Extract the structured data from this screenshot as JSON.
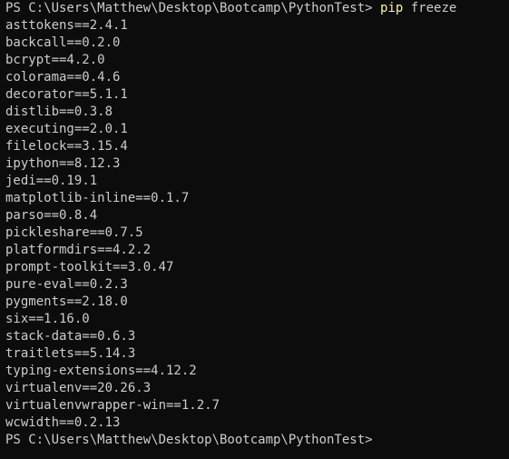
{
  "terminal": {
    "prompt": "PS C:\\Users\\Matthew\\Desktop\\Bootcamp\\PythonTest> ",
    "command_name": "pip",
    "command_args": " freeze",
    "output_lines": [
      "asttokens==2.4.1",
      "backcall==0.2.0",
      "bcrypt==4.2.0",
      "colorama==0.4.6",
      "decorator==5.1.1",
      "distlib==0.3.8",
      "executing==2.0.1",
      "filelock==3.15.4",
      "ipython==8.12.3",
      "jedi==0.19.1",
      "matplotlib-inline==0.1.7",
      "parso==0.8.4",
      "pickleshare==0.7.5",
      "platformdirs==4.2.2",
      "prompt-toolkit==3.0.47",
      "pure-eval==0.2.3",
      "pygments==2.18.0",
      "six==1.16.0",
      "stack-data==0.6.3",
      "traitlets==5.14.3",
      "typing-extensions==4.12.2",
      "virtualenv==20.26.3",
      "virtualenvwrapper-win==1.2.7",
      "wcwidth==0.2.13"
    ],
    "final_prompt": "PS C:\\Users\\Matthew\\Desktop\\Bootcamp\\PythonTest>",
    "colors": {
      "background": "#0c0c0c",
      "text": "#cccccc",
      "command": "#f9f1a5"
    }
  }
}
